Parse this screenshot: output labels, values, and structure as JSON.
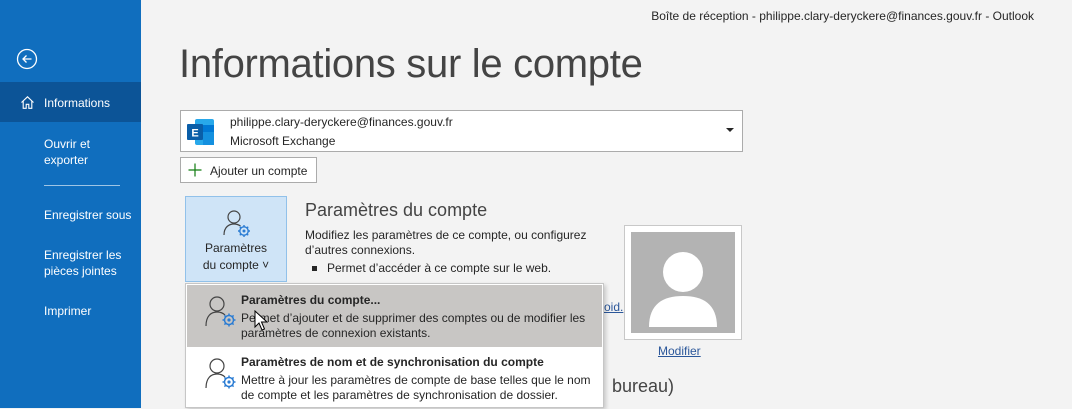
{
  "window": {
    "title": "Boîte de réception - philippe.clary-deryckere@finances.gouv.fr  -  Outlook"
  },
  "nav": {
    "back_icon": "back-arrow-icon",
    "items": [
      {
        "label": "Informations",
        "icon": "home-icon",
        "active": true
      },
      {
        "label_line1": "Ouvrir et",
        "label_line2": "exporter"
      },
      {
        "label": "Enregistrer sous"
      },
      {
        "label_line1": "Enregistrer les",
        "label_line2": "pièces jointes"
      },
      {
        "label": "Imprimer"
      }
    ]
  },
  "main": {
    "title": "Informations sur le compte",
    "account": {
      "email": "philippe.clary-deryckere@finances.gouv.fr",
      "type": "Microsoft Exchange",
      "icon": "exchange-icon"
    },
    "add_account_label": "Ajouter un compte",
    "settings_button": {
      "line1": "Paramètres",
      "line2": "du compte ˅"
    },
    "section": {
      "title": "Paramètres du compte",
      "description": "Modifiez les paramètres de ce compte, ou configurez d’autres connexions.",
      "bullet": "Permet d’accéder à ce compte sur le web.",
      "link_fragment": "oid."
    },
    "modify_link": "Modifier",
    "partial_heading": "bureau)",
    "partial_text": "..."
  },
  "menu": {
    "items": [
      {
        "title": "Paramètres du compte...",
        "description": "Permet d’ajouter et de supprimer des comptes ou de modifier les paramètres de connexion existants.",
        "icon": "account-settings-icon"
      },
      {
        "title": "Paramètres de nom et de synchronisation du compte",
        "description": "Mettre à jour les paramètres de compte de base telles que le nom de compte et les paramètres de synchronisation de dossier.",
        "icon": "account-sync-settings-icon"
      }
    ]
  },
  "colors": {
    "nav_bg": "#106ebe",
    "nav_active": "#0c5497",
    "accent": "#2b579a",
    "button_highlight": "#cfe4f7",
    "menu_hover": "#c8c6c4"
  }
}
